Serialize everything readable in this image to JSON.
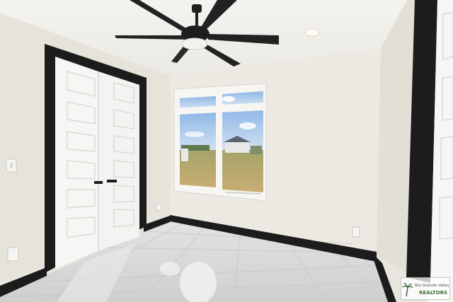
{
  "scene": {
    "subject": "empty-bedroom",
    "features": [
      "ceiling-fan",
      "recessed-light",
      "double-door-closet",
      "window",
      "tile-floor",
      "black-baseboards",
      "outlets",
      "light-switch"
    ]
  },
  "colors": {
    "wall": "#ebe8e0",
    "ceiling": "#f3f2ee",
    "trim": "#1c1c1c",
    "door": "#f6f6f4",
    "floor": "#dcdcdc",
    "sky": "#a9c9ea",
    "grass": "#b9a56d"
  },
  "watermark": {
    "text": "Rio Grande Valley REALTORS MLS",
    "is_logo": true
  }
}
